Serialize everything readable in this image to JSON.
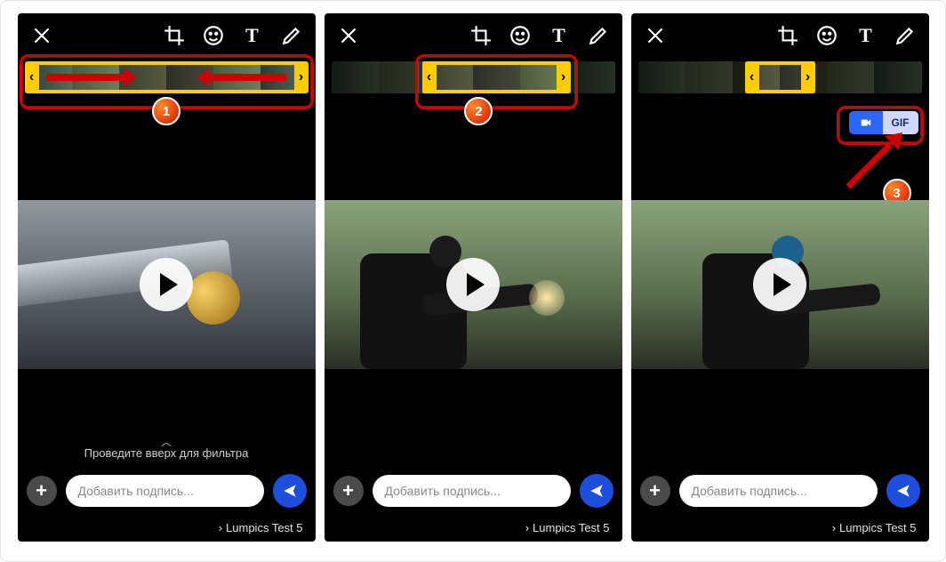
{
  "toolbar": {
    "close": "close",
    "crop": "crop",
    "emoji": "emoji",
    "text_tool": "T",
    "draw": "draw"
  },
  "swipe_hint": "Проведите вверх для фильтра",
  "caption_placeholder": "Добавить подпись...",
  "recipient": "Lumpics Test 5",
  "gif_toggle": {
    "video": "video",
    "gif": "GIF"
  },
  "callouts": {
    "step1": "1",
    "step2": "2",
    "step3": "3"
  },
  "timeline_handles": {
    "left": "‹",
    "right": "›"
  }
}
